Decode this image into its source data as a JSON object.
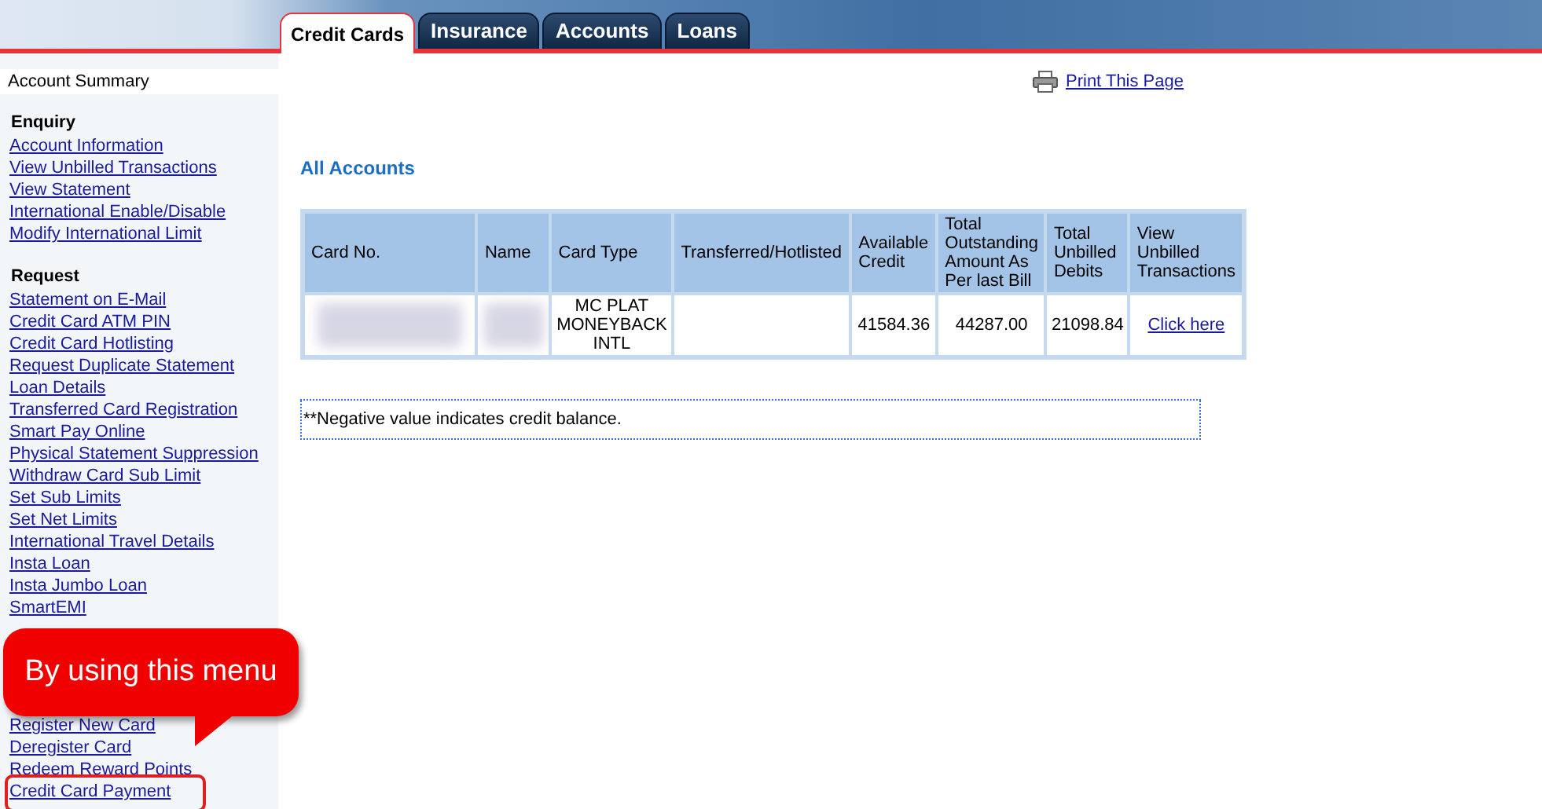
{
  "tabs": [
    {
      "label": "Credit Cards",
      "selected": true
    },
    {
      "label": "Insurance",
      "selected": false
    },
    {
      "label": "Accounts",
      "selected": false
    },
    {
      "label": "Loans",
      "selected": false
    }
  ],
  "sidebar": {
    "top_item": "Account Summary",
    "sections": [
      {
        "heading": "Enquiry",
        "items": [
          "Account Information",
          "View Unbilled Transactions",
          "View Statement",
          "International Enable/Disable",
          "Modify International Limit"
        ]
      },
      {
        "heading": "Request",
        "items": [
          "Statement on E-Mail",
          "Credit Card ATM PIN",
          "Credit Card Hotlisting",
          "Request Duplicate Statement",
          "Loan Details",
          "Transferred Card Registration",
          "Smart Pay Online",
          "Physical Statement Suppression",
          "Withdraw Card Sub Limit",
          "Set Sub Limits",
          "Set Net Limits",
          "International Travel Details",
          "Insta Loan",
          "Insta Jumbo Loan",
          "SmartEMI"
        ],
        "items_after_callout": [
          "Register New Card",
          "Deregister Card",
          "Redeem Reward Points",
          "Credit Card Payment"
        ]
      }
    ]
  },
  "callout": {
    "text": "By using this menu"
  },
  "print_link": "Print This Page",
  "heading": "All Accounts",
  "table": {
    "columns": [
      "Card No.",
      "Name",
      "Card Type",
      "Transferred/Hotlisted",
      "Available Credit",
      "Total Outstanding Amount As Per last Bill",
      "Total Unbilled Debits",
      "View Unbilled Transactions"
    ],
    "rows": [
      {
        "card_no_redacted": true,
        "name_redacted": true,
        "card_type": "MC PLAT MONEYBACK INTL",
        "available_credit": "41584.36",
        "total_outstanding": "44287.00",
        "total_unbilled": "21098.84",
        "link": "Click here"
      }
    ]
  },
  "note": "**Negative value indicates credit balance."
}
